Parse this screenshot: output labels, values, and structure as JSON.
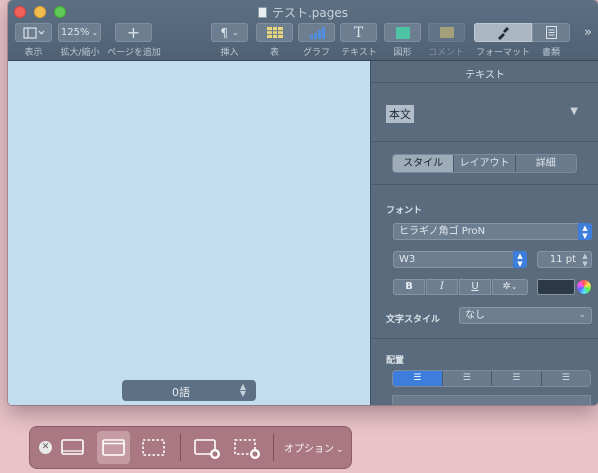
{
  "window": {
    "title": "テスト.pages"
  },
  "toolbar": {
    "view_label": "表示",
    "zoom_value": "125%",
    "zoom_label": "拡大/縮小",
    "add_page_label": "ページを追加",
    "insert_label": "挿入",
    "table_label": "表",
    "chart_label": "グラフ",
    "text_label": "テキスト",
    "shape_label": "図形",
    "comment_label": "コメント",
    "format_label": "フォーマット",
    "document_label": "書類"
  },
  "canvas": {
    "word_count": "0語"
  },
  "inspector": {
    "header": "テキスト",
    "paragraph_style": "本文",
    "tabs": [
      "スタイル",
      "レイアウト",
      "詳細"
    ],
    "font_section": "フォント",
    "font_family": "ヒラギノ角ゴ ProN",
    "font_weight": "W3",
    "font_size": "11 pt",
    "bold_label": "B",
    "italic_label": "I",
    "underline_label": "U",
    "char_style_label": "文字スタイル",
    "char_style_value": "なし",
    "alignment_section": "配置"
  },
  "screenshot_toolbar": {
    "options_label": "オプション"
  },
  "colors": {
    "accent_blue": "#3d7ddb",
    "canvas_bg": "#c2dcf0",
    "desktop_bg": "#e8c3c9"
  }
}
